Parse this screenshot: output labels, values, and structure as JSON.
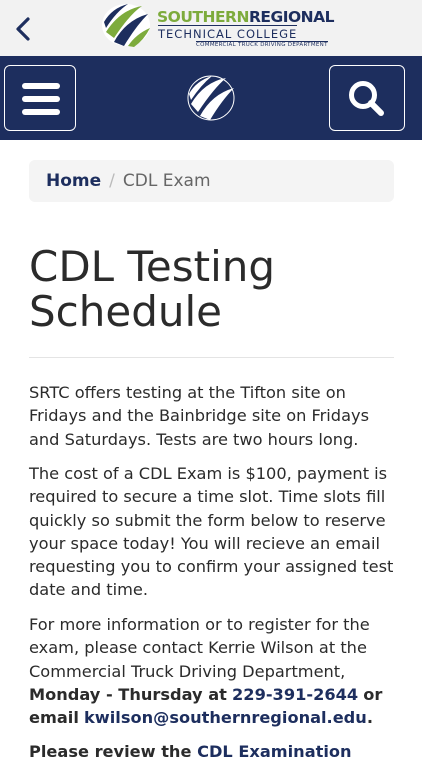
{
  "header": {
    "logo_name_part1": "SOUTHERN",
    "logo_name_part2": "REGIONAL",
    "logo_subtitle": "TECHNICAL COLLEGE",
    "logo_department": "COMMERCIAL TRUCK DRIVING DEPARTMENT",
    "back_icon": "chevron-left-icon",
    "menu_icon": "hamburger-menu-icon",
    "search_icon": "search-icon"
  },
  "breadcrumb": {
    "home": "Home",
    "separator": "/",
    "current": "CDL Exam"
  },
  "page": {
    "title": "CDL Testing Schedule",
    "p1": "SRTC offers testing at the Tifton site on Fridays and the Bainbridge site on Fridays and Saturdays. Tests are two hours long.",
    "p2": "The cost of a CDL Exam is $100, payment is required to secure a time slot. Time slots fill quickly so submit the form below to reserve your space today! You will recieve an email requesting you to confirm your assigned test date and time.",
    "p3_text": "For more information or to register for the exam, please contact Kerrie Wilson at the Commercial Truck Driving Department,",
    "p3_hours": "Monday - Thursday at",
    "p3_phone": "229-391-2644",
    "p3_or": "or email",
    "p3_email": "kwilson@southernregional.edu",
    "p3_end": ".",
    "p4_start": "Please review the",
    "p4_link": "CDL Examination"
  },
  "colors": {
    "navy": "#1d2e5e",
    "green": "#7dab3c",
    "header_bg": "#f2f2f2",
    "breadcrumb_bg": "#f4f4f4"
  }
}
